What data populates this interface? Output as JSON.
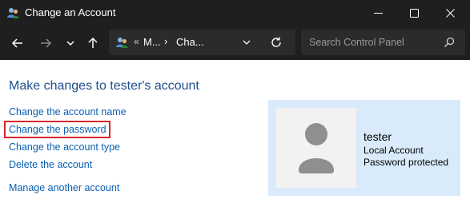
{
  "window": {
    "title": "Change an Account",
    "app_icon": "users-icon"
  },
  "toolbar": {
    "breadcrumb_sep0": "«",
    "crumb1": "M...",
    "crumb_sep": "›",
    "crumb2": "Cha...",
    "search_placeholder": "Search Control Panel"
  },
  "content": {
    "heading": "Make changes to tester's account",
    "links": [
      "Change the account name",
      "Change the password",
      "Change the account type",
      "Delete the account",
      "Manage another account"
    ],
    "highlighted_link_index": 1
  },
  "user": {
    "name": "tester",
    "account_type": "Local Account",
    "status": "Password protected"
  },
  "colors": {
    "titlebar_bg": "#1f1f1f",
    "heading": "#1e4e8c",
    "link": "#0b5fb3",
    "card_bg": "#d9ebfb",
    "highlight": "#d9262b"
  }
}
